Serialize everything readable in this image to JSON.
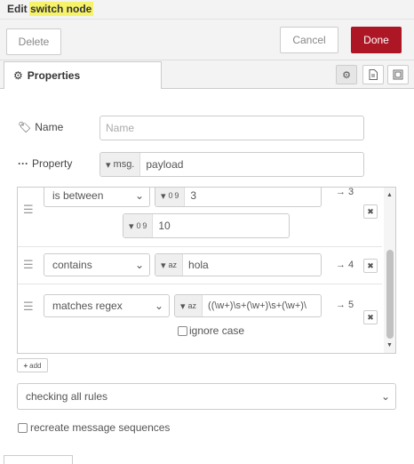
{
  "window": {
    "title": "Edit switch node"
  },
  "toolbar": {
    "delete_label": "Delete",
    "cancel_label": "Cancel",
    "done_label": "Done"
  },
  "tabs": {
    "properties_label": "Properties"
  },
  "form": {
    "name_label": "Name",
    "name_placeholder": "Name",
    "property_label": "Property",
    "property_type": "msg.",
    "property_value": "payload"
  },
  "rules": [
    {
      "operator": "is between",
      "value1_type": "0 9",
      "value1": "3",
      "value2_type": "0 9",
      "value2": "10",
      "output": "→ 3"
    },
    {
      "operator": "contains",
      "value_type": "az",
      "value": "hola",
      "output": "→ 4"
    },
    {
      "operator": "matches regex",
      "value_type": "az",
      "value": "((\\w+)\\s+(\\w+)\\s+(\\w+)\\",
      "ignore_case_label": "ignore case",
      "output": "→ 5"
    }
  ],
  "add_label": "add",
  "check_mode": "checking all rules",
  "recreate_label": "recreate message sequences"
}
